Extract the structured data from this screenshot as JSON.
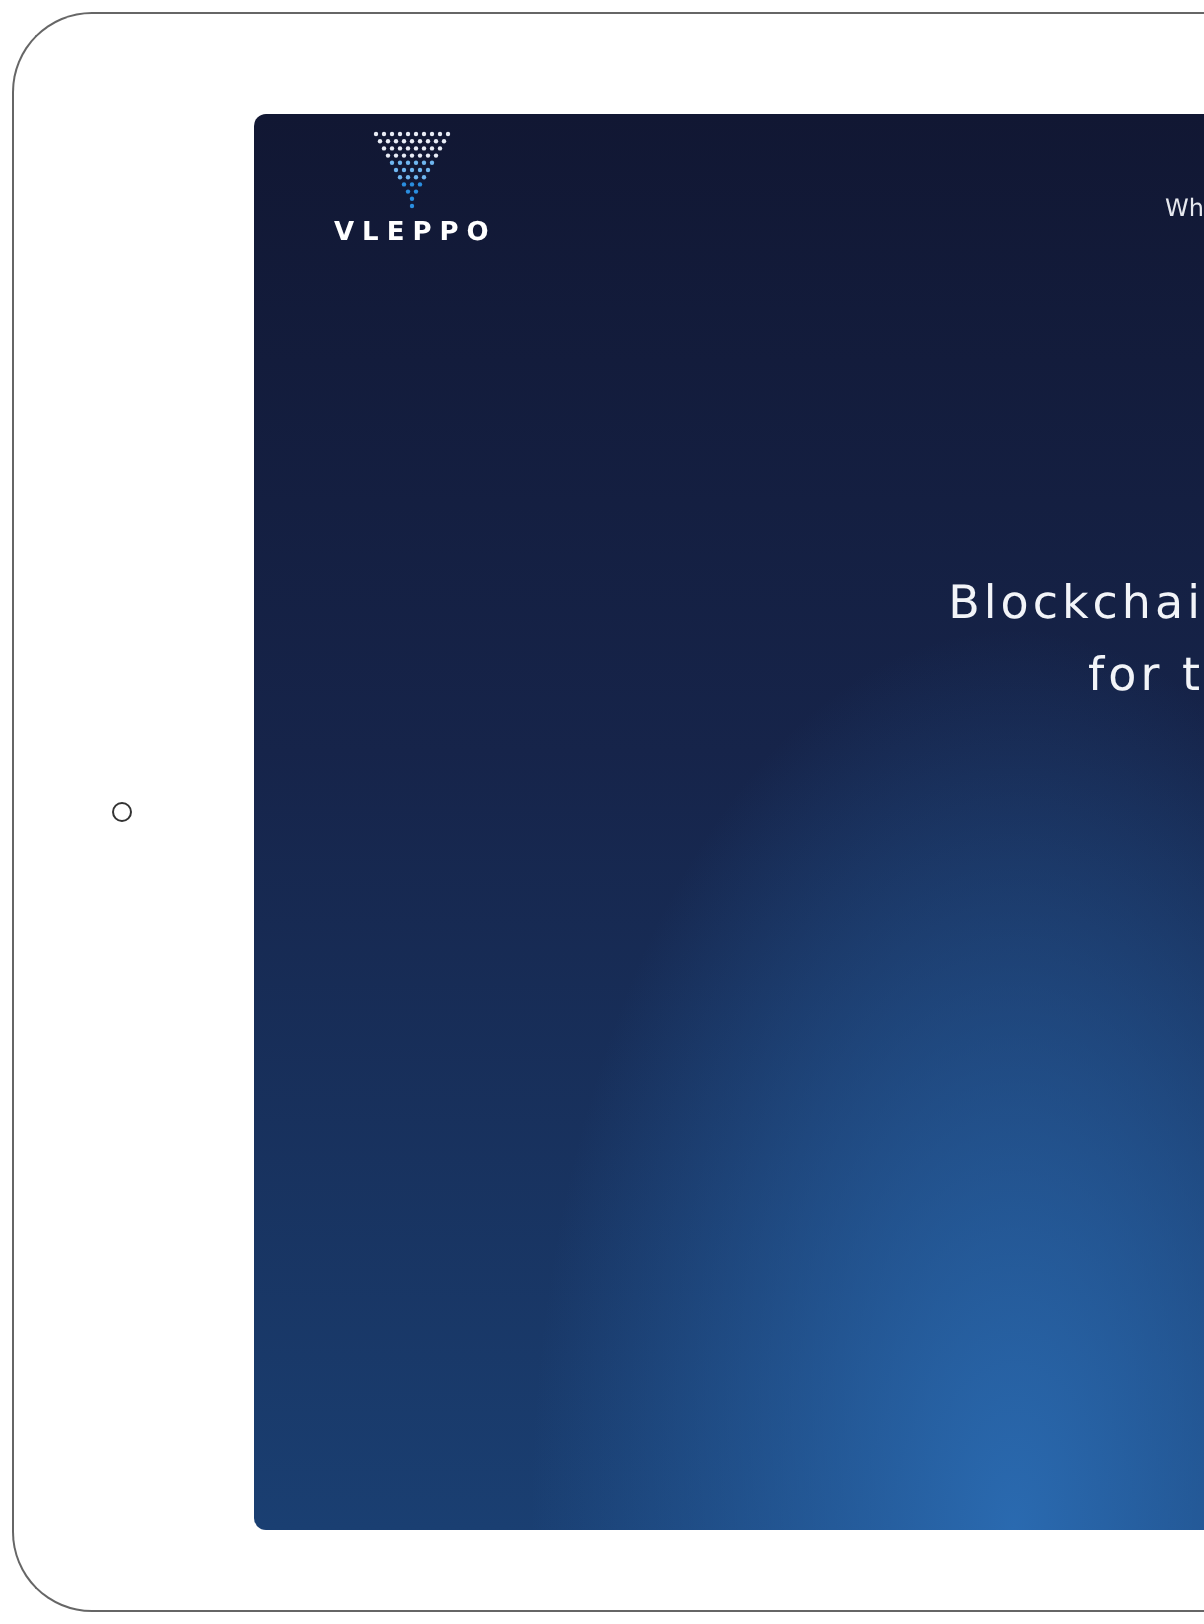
{
  "device": {
    "kind": "tablet"
  },
  "site": {
    "logo": "VLEPPO",
    "nav_link": "Wh"
  },
  "hero": {
    "headline": [
      "Blockchai",
      "for t"
    ]
  }
}
